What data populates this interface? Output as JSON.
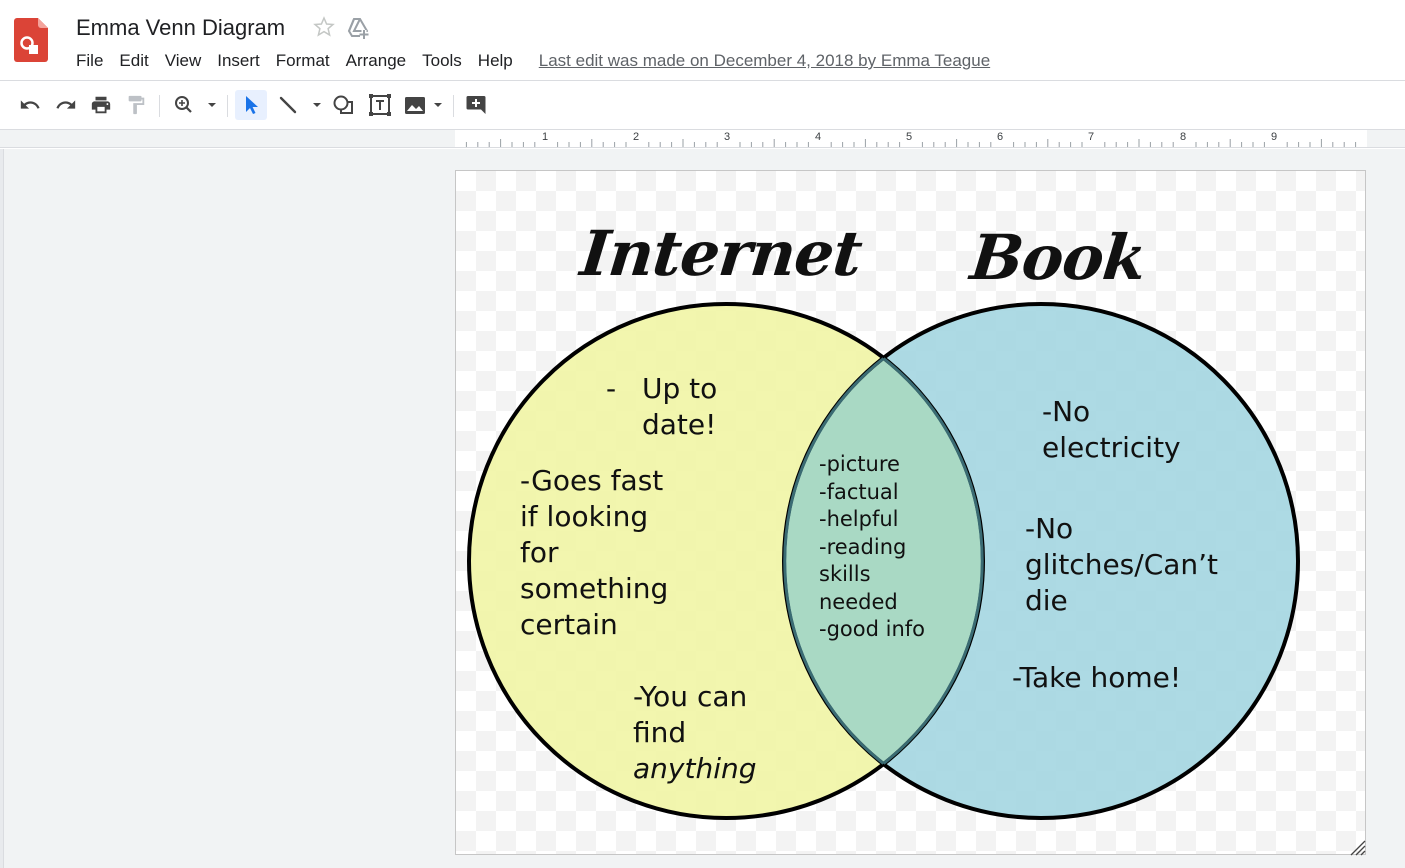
{
  "app": {
    "title": "Emma Venn Diagram",
    "icons": {
      "logo": "google-drawings-logo",
      "star": "star-icon",
      "drive": "move-to-drive-icon"
    }
  },
  "menu": {
    "items": [
      "File",
      "Edit",
      "View",
      "Insert",
      "Format",
      "Arrange",
      "Tools",
      "Help"
    ],
    "last_edit": "Last edit was made on December 4, 2018 by Emma Teague"
  },
  "toolbar": {
    "buttons": [
      "undo-icon",
      "redo-icon",
      "print-icon",
      "paint-format-icon",
      "zoom-icon",
      "select-icon",
      "line-icon",
      "shape-icon",
      "text-box-icon",
      "image-icon",
      "comment-icon"
    ],
    "active": "select-icon"
  },
  "ruler": {
    "numbers": [
      "1",
      "2",
      "3",
      "4",
      "5",
      "6",
      "7",
      "8",
      "9"
    ]
  },
  "diagram": {
    "left_title": "Internet",
    "right_title": "Book",
    "left_color": "#f0f5a0",
    "right_color": "#9fd3df",
    "overlap_color": "#a9d9c4",
    "left_items": {
      "item1_dash": "-",
      "item1": "Up to\ndate!",
      "item2": "-Goes fast\nif looking\nfor\nsomething\ncertain",
      "item3_line1": "-You can",
      "item3_line2": "find",
      "item3_line3": "anything"
    },
    "middle_items": "-picture\n-factual\n-helpful\n-reading\nskills\nneeded\n-good info",
    "right_items": {
      "item1": "-No\nelectricity",
      "item2": "-No\nglitches/Can’t\ndie",
      "item3": "-Take home!"
    }
  }
}
